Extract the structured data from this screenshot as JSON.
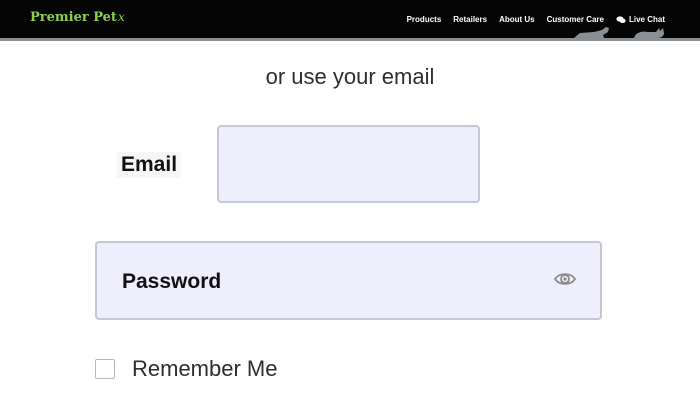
{
  "header": {
    "brand_name": "Premier Pet",
    "brand_mark": "x",
    "nav": [
      {
        "label": "Products"
      },
      {
        "label": "Retailers"
      },
      {
        "label": "About Us"
      },
      {
        "label": "Customer Care"
      },
      {
        "label": "Live Chat",
        "icon": "chat-bubbles-icon"
      }
    ],
    "decoration_icon": "dog-and-cat-silhouette"
  },
  "form": {
    "subtitle": "or use your email",
    "email": {
      "label": "Email",
      "value": "",
      "placeholder": ""
    },
    "password": {
      "label": "Password",
      "value": "",
      "toggle_icon": "eye-icon"
    },
    "remember_me": {
      "label": "Remember Me",
      "checked": false
    }
  },
  "colors": {
    "header_bg": "#050505",
    "brand_green": "#8ad14a",
    "input_bg": "#eeeefc",
    "input_border": "#c5c7d4"
  }
}
